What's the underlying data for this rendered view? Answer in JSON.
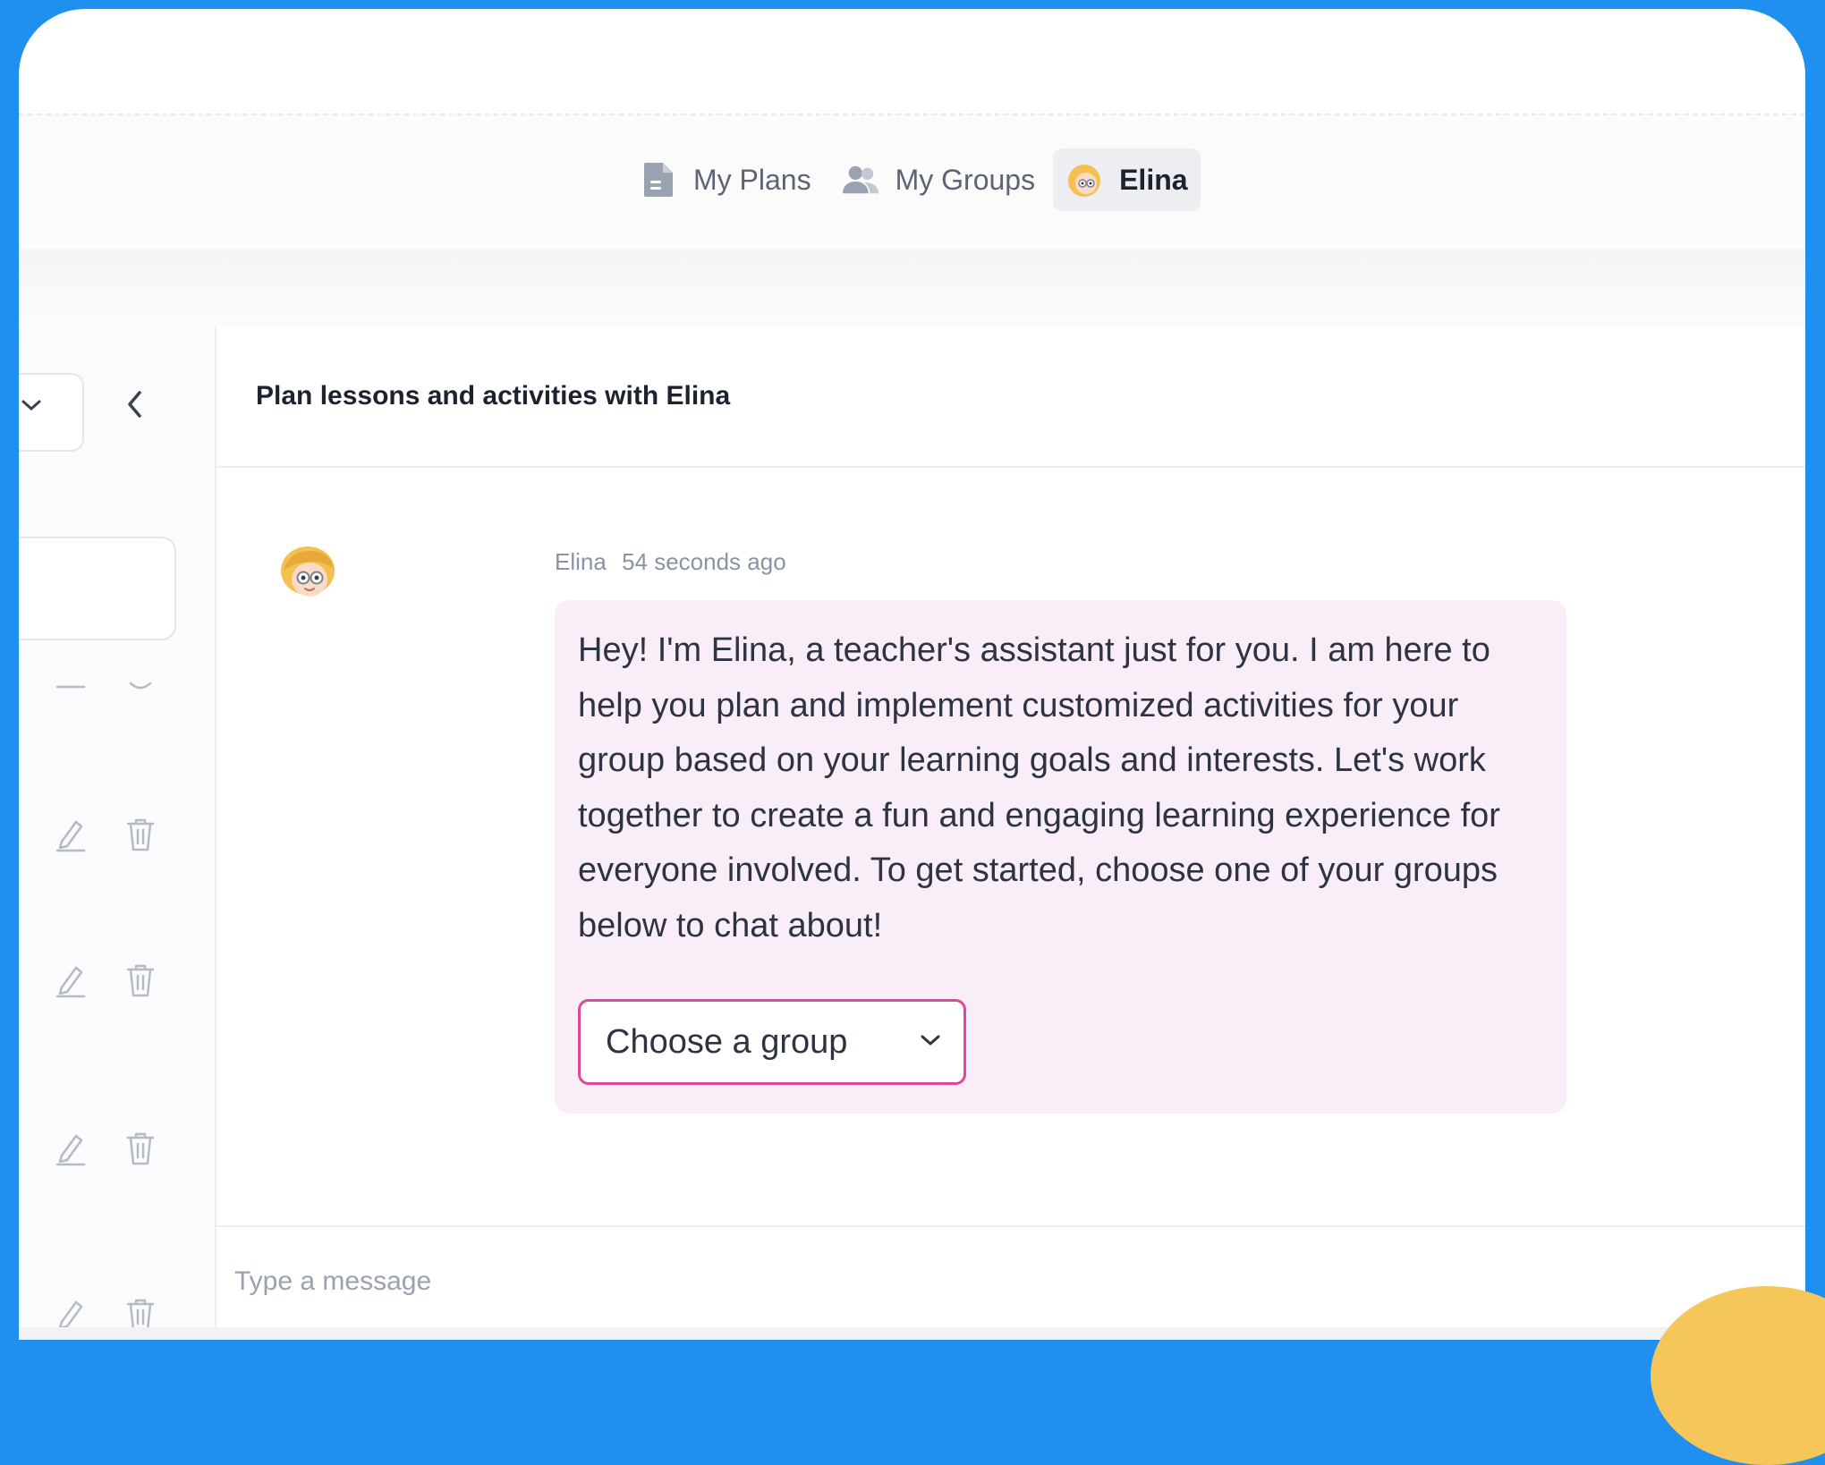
{
  "nav": {
    "items": [
      {
        "label": "My Plans",
        "icon": "document-icon",
        "active": false
      },
      {
        "label": "My Groups",
        "icon": "people-icon",
        "active": false
      },
      {
        "label": "Elina",
        "icon": "elina-avatar-icon",
        "active": true
      }
    ]
  },
  "chat": {
    "title": "Plan lessons and activities with Elina",
    "message": {
      "author": "Elina",
      "time": "54 seconds ago",
      "text": "Hey! I'm Elina, a teacher's assistant just for you. I am here to help you plan and implement customized activities for your group based on your learning goals and interests. Let's work together to create a fun and engaging learning experience for everyone involved. To get started, choose one of your groups below to chat about!",
      "select_placeholder": "Choose a group"
    },
    "composer": {
      "placeholder": "Type a message"
    }
  },
  "colors": {
    "frame": "#1f90f0",
    "bubble": "#f9eef8",
    "select_border": "#e0479a",
    "accent_blob": "#f5c75a"
  }
}
